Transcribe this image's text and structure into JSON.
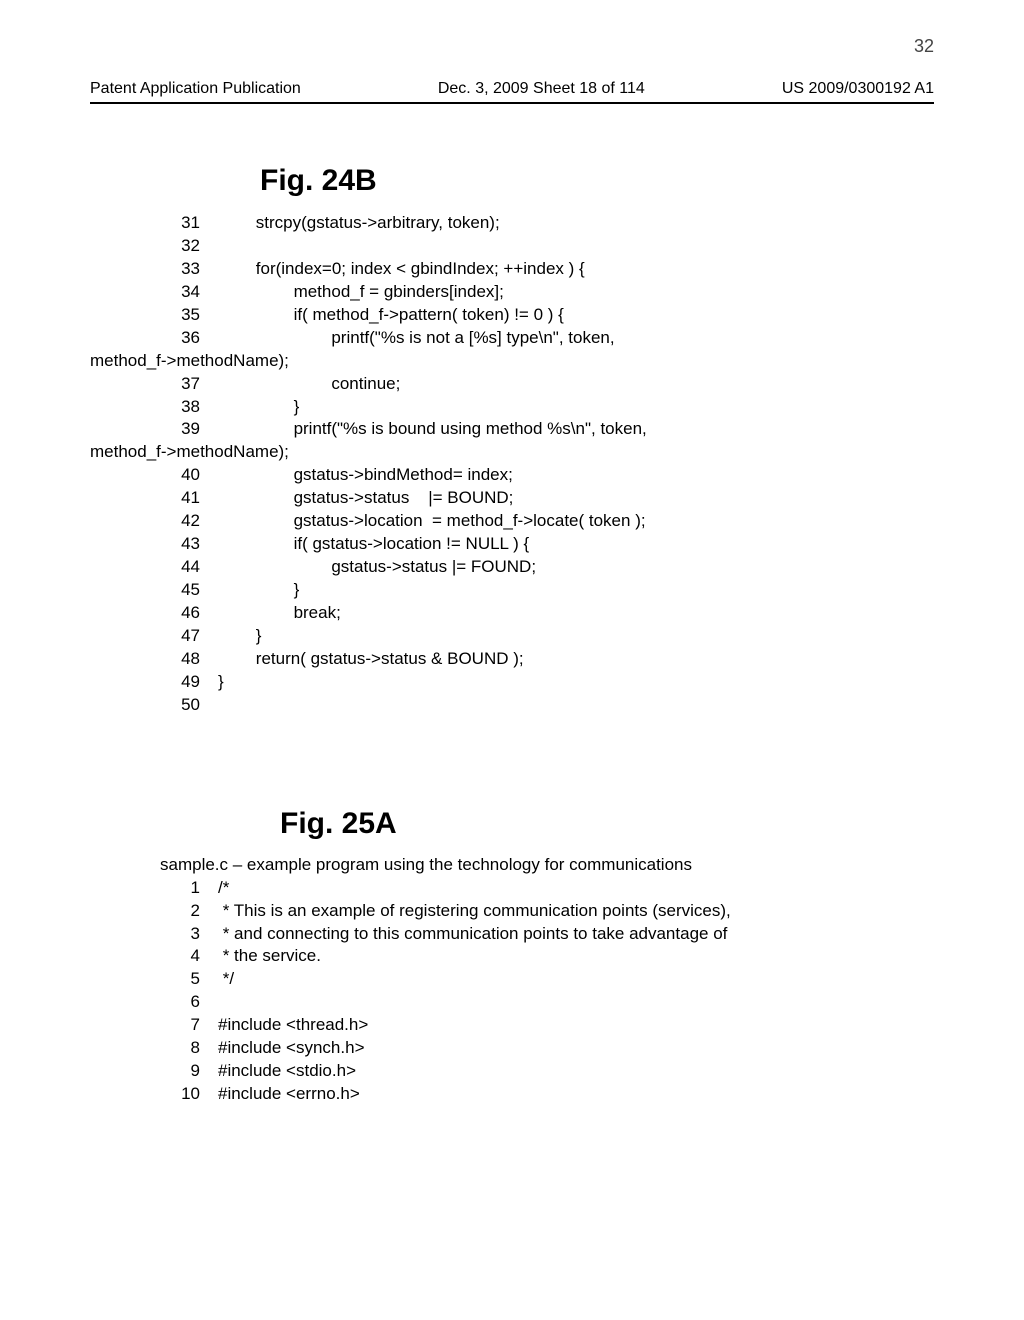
{
  "page_number_top": "32",
  "header": {
    "left": "Patent Application Publication",
    "center": "Dec. 3, 2009  Sheet 18 of 114",
    "right": "US 2009/0300192 A1"
  },
  "fig24b": {
    "title": "Fig. 24B",
    "lines": [
      {
        "n": "31",
        "t": "        strcpy(gstatus->arbitrary, token);"
      },
      {
        "n": "32",
        "t": ""
      },
      {
        "n": "33",
        "t": "        for(index=0; index < gbindIndex; ++index ) {"
      },
      {
        "n": "34",
        "t": "                method_f = gbinders[index];"
      },
      {
        "n": "35",
        "t": "                if( method_f->pattern( token) != 0 ) {"
      },
      {
        "n": "36",
        "t": "                        printf(\"%s is not a [%s] type\\n\", token,"
      },
      {
        "n": "",
        "t": "method_f->methodName);",
        "wrap": true
      },
      {
        "n": "37",
        "t": "                        continue;"
      },
      {
        "n": "38",
        "t": "                }"
      },
      {
        "n": "39",
        "t": "                printf(\"%s is bound using method %s\\n\", token,"
      },
      {
        "n": "",
        "t": "method_f->methodName);",
        "wrap": true
      },
      {
        "n": "40",
        "t": "                gstatus->bindMethod= index;"
      },
      {
        "n": "41",
        "t": "                gstatus->status    |= BOUND;"
      },
      {
        "n": "42",
        "t": "                gstatus->location  = method_f->locate( token );"
      },
      {
        "n": "43",
        "t": "                if( gstatus->location != NULL ) {"
      },
      {
        "n": "44",
        "t": "                        gstatus->status |= FOUND;"
      },
      {
        "n": "45",
        "t": "                }"
      },
      {
        "n": "46",
        "t": "                break;"
      },
      {
        "n": "47",
        "t": "        }"
      },
      {
        "n": "48",
        "t": "        return( gstatus->status & BOUND );"
      },
      {
        "n": "49",
        "t": "}"
      },
      {
        "n": "50",
        "t": ""
      }
    ]
  },
  "fig25a": {
    "title": "Fig. 25A",
    "caption": "sample.c – example program using the technology for communications",
    "lines": [
      {
        "n": "1",
        "t": "/*"
      },
      {
        "n": "2",
        "t": " * This is an example of registering communication points (services),"
      },
      {
        "n": "3",
        "t": " * and connecting to this communication points to take advantage of"
      },
      {
        "n": "4",
        "t": " * the service."
      },
      {
        "n": "5",
        "t": " */"
      },
      {
        "n": "6",
        "t": ""
      },
      {
        "n": "7",
        "t": "#include <thread.h>"
      },
      {
        "n": "8",
        "t": "#include <synch.h>"
      },
      {
        "n": "9",
        "t": "#include <stdio.h>"
      },
      {
        "n": "10",
        "t": "#include <errno.h>"
      }
    ]
  }
}
